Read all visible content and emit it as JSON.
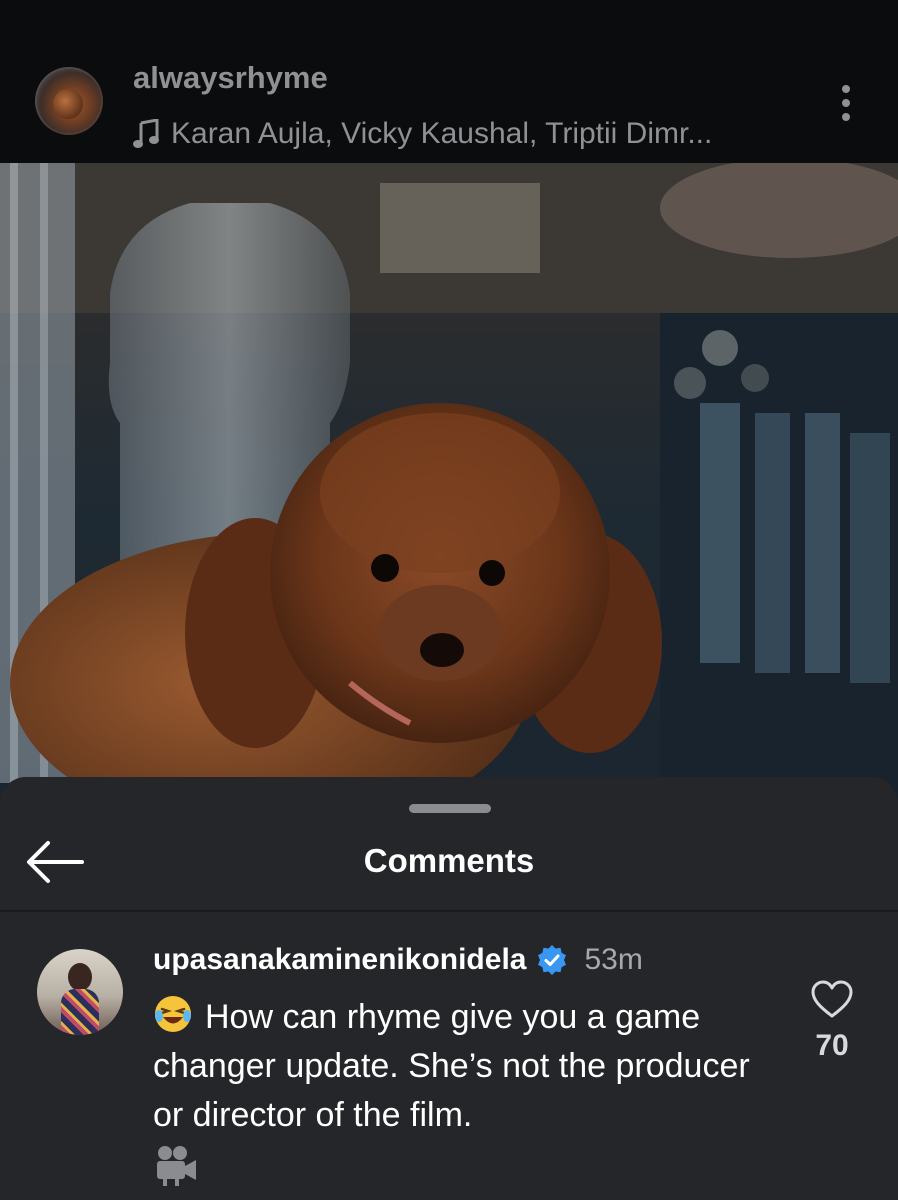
{
  "header": {
    "username": "alwaysrhyme",
    "music": "Karan Aujla, Vicky Kaushal, Triptii Dimr..."
  },
  "comments_sheet": {
    "title": "Comments",
    "comments": [
      {
        "username": "upasanakaminenikonidela",
        "verified": true,
        "time": "53m",
        "text": "How can rhyme give you a game changer update. She’s not the producer or director of the film.",
        "likes": "70"
      }
    ]
  },
  "colors": {
    "background": "#101114",
    "sheet": "#242629",
    "verified_badge": "#3897f0"
  },
  "icons": [
    "music-note-icon",
    "more-vertical-icon",
    "back-arrow-icon",
    "verified-badge-icon",
    "laughing-emoji-icon",
    "movie-camera-emoji-icon",
    "heart-outline-icon"
  ]
}
